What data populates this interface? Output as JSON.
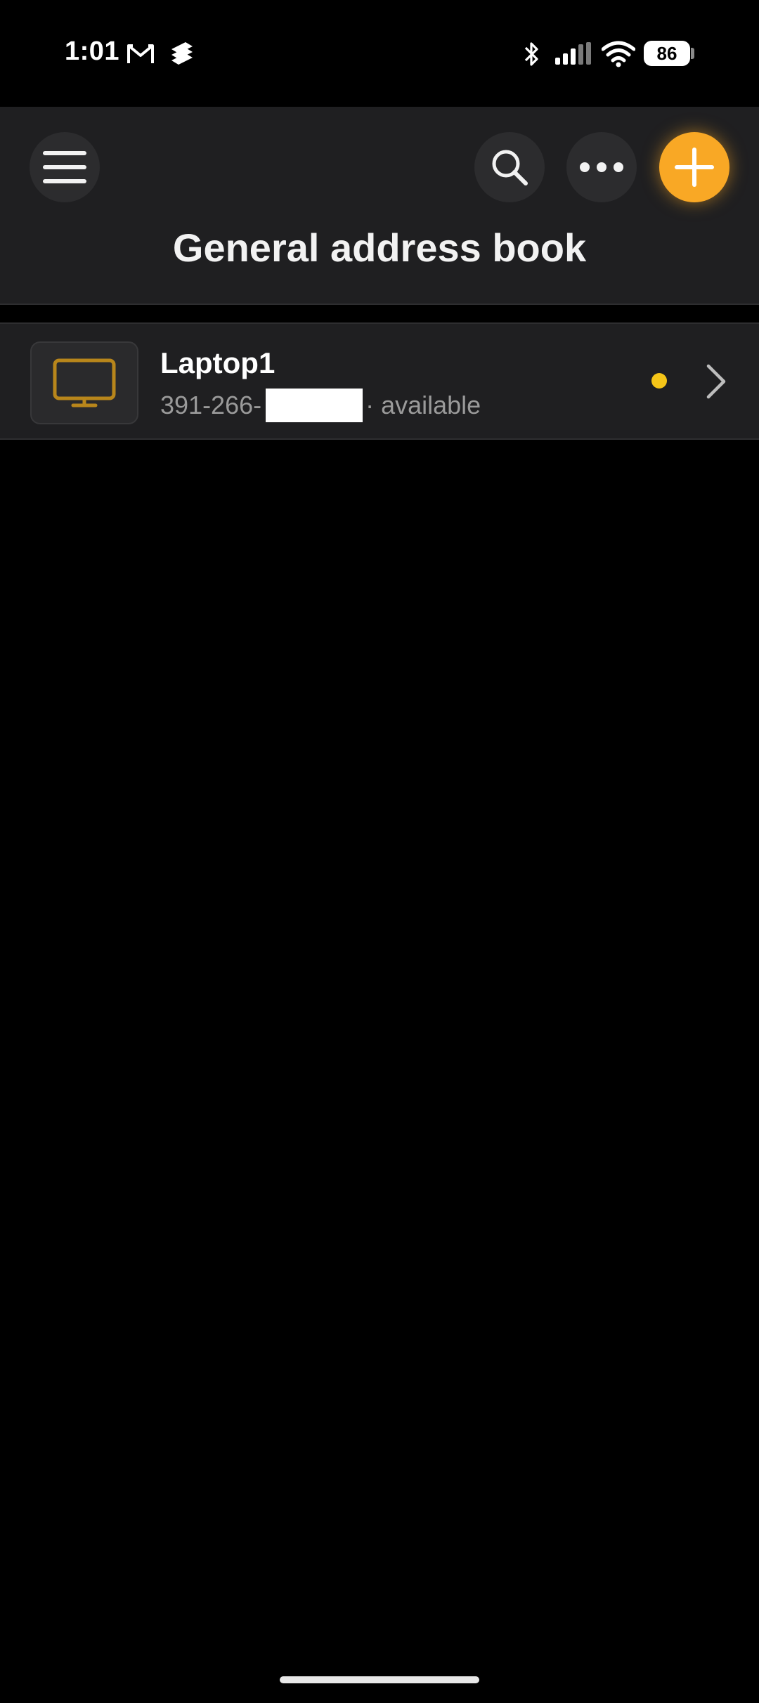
{
  "status_bar": {
    "time": "1:01",
    "battery": "86",
    "icons": [
      "gmail-icon",
      "app-notification-icon",
      "bluetooth-icon",
      "signal-icon",
      "wifi-icon",
      "battery-icon"
    ]
  },
  "header": {
    "title": "General address book",
    "buttons": [
      "menu-icon",
      "search-icon",
      "more-icon",
      "add-icon"
    ],
    "accent_color": "#f9a825"
  },
  "devices": [
    {
      "name": "Laptop1",
      "id_prefix": "391-266-",
      "status": "· available",
      "status_color": "#f5c518",
      "icon": "monitor-icon"
    }
  ]
}
